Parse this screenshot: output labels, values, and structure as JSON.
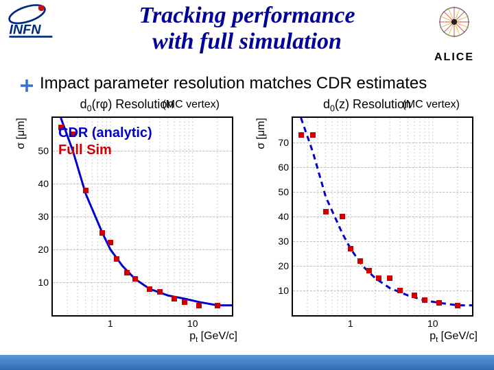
{
  "title_line1": "Tracking performance",
  "title_line2": "with full simulation",
  "bullet_text": "Impact parameter resolution matches CDR estimates",
  "legend": {
    "analytic": "CDR (analytic)",
    "fullsim": "Full Sim"
  },
  "logo_left_text": "INFN",
  "logo_right_text": "ALICE",
  "chart_data": [
    {
      "type": "scatter",
      "title": "d0(rφ) Resolution",
      "subtitle": "(MC vertex)",
      "xlabel": "pt [GeV/c]",
      "ylabel": "σ [μm]",
      "xscale": "log",
      "xlim": [
        0.2,
        30
      ],
      "ylim": [
        0,
        60
      ],
      "yticks": [
        10,
        20,
        30,
        40,
        50
      ],
      "xticks_major": [
        1,
        10
      ],
      "series": [
        {
          "name": "Full Sim",
          "type": "points",
          "color": "#cc0000",
          "x": [
            0.25,
            0.35,
            0.5,
            0.8,
            1,
            1.2,
            1.6,
            2.0,
            3.0,
            4.0,
            6.0,
            8.0,
            12,
            20
          ],
          "y": [
            57,
            55,
            38,
            25,
            22,
            17,
            13,
            11,
            8,
            7,
            5,
            4,
            3,
            3
          ]
        },
        {
          "name": "CDR (analytic)",
          "type": "curve",
          "color": "#0000cc",
          "style": "solid",
          "formula_note": "monotone decreasing ~1/pt",
          "x": [
            0.25,
            0.35,
            0.5,
            0.8,
            1,
            1.4,
            2,
            3,
            5,
            8,
            12,
            20,
            30
          ],
          "y": [
            60,
            50,
            37,
            25,
            20,
            15,
            11,
            8,
            6,
            5,
            4,
            3,
            3
          ]
        }
      ]
    },
    {
      "type": "scatter",
      "title": "d0(z) Resolution",
      "subtitle": "(MC vertex)",
      "xlabel": "pt [GeV/c]",
      "ylabel": "σ [μm]",
      "xscale": "log",
      "xlim": [
        0.2,
        30
      ],
      "ylim": [
        0,
        80
      ],
      "yticks": [
        10,
        20,
        30,
        40,
        50,
        60,
        70
      ],
      "xticks_major": [
        1,
        10
      ],
      "series": [
        {
          "name": "Full Sim",
          "type": "points",
          "color": "#cc0000",
          "x": [
            0.25,
            0.35,
            0.5,
            0.8,
            1,
            1.3,
            1.7,
            2.2,
            3.0,
            4.0,
            6.0,
            8.0,
            12,
            20
          ],
          "y": [
            73,
            73,
            42,
            40,
            27,
            22,
            18,
            15,
            15,
            10,
            8,
            6,
            5,
            4
          ]
        },
        {
          "name": "CDR (analytic)",
          "type": "curve",
          "color": "#0000cc",
          "style": "dashed",
          "formula_note": "monotone decreasing ~1/pt",
          "x": [
            0.25,
            0.35,
            0.5,
            0.8,
            1,
            1.4,
            2,
            3,
            5,
            8,
            12,
            20,
            30
          ],
          "y": [
            80,
            66,
            48,
            33,
            27,
            20,
            15,
            11,
            8,
            6,
            5,
            4,
            4
          ]
        }
      ]
    }
  ]
}
